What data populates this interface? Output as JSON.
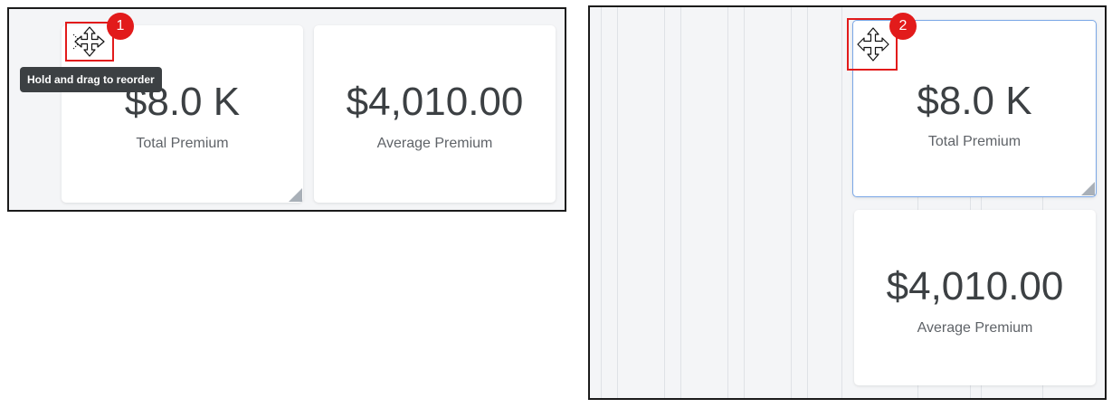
{
  "panel_1": {
    "cards": [
      {
        "value": "$8.0 K",
        "label": "Total Premium"
      },
      {
        "value": "$4,010.00",
        "label": "Average Premium"
      }
    ],
    "step_badge": "1",
    "tooltip": "Hold and drag to reorder",
    "drag_icon": "move-icon"
  },
  "panel_2": {
    "cards": [
      {
        "value": "$8.0 K",
        "label": "Total Premium"
      },
      {
        "value": "$4,010.00",
        "label": "Average Premium"
      }
    ],
    "step_badge": "2",
    "drag_icon": "move-icon"
  },
  "colors": {
    "highlight": "#e21b1b",
    "tooltip_bg": "#3c4043",
    "card_bg": "#ffffff",
    "panel_bg": "#f4f5f7",
    "drag_outline": "#7aa7e6"
  }
}
